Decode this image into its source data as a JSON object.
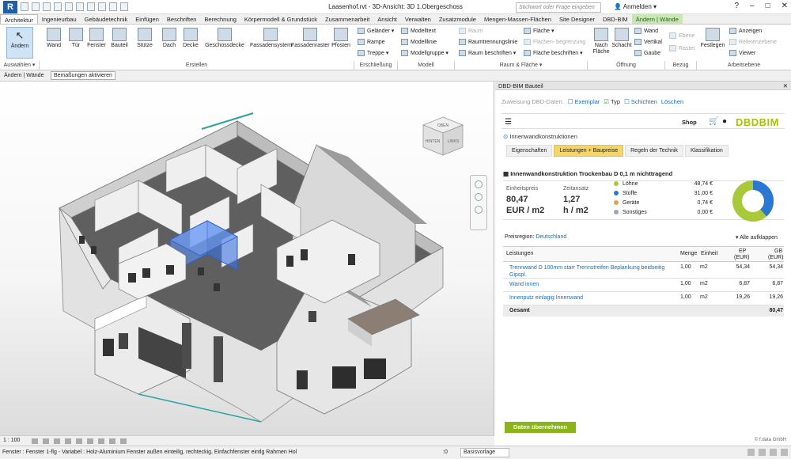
{
  "window": {
    "title": "Laasenhof.rvt - 3D-Ansicht: 3D 1.Obergeschoss",
    "search_placeholder": "Stichwort oder Frage eingeben",
    "signin": "Anmelden",
    "help": "?"
  },
  "ribbon_tabs": [
    "Architektur",
    "Ingenieurbau",
    "Gebäudetechnik",
    "Einfügen",
    "Beschriften",
    "Berechnung",
    "Körpermodell & Grundstück",
    "Zusammenarbeit",
    "Ansicht",
    "Verwalten",
    "Zusatzmodule",
    "Mengen-Massen-Flächen",
    "Site Designer",
    "DBD-BIM",
    "Ändern | Wände"
  ],
  "ribbon": {
    "modify": "Ändern",
    "select": "Auswählen ▾",
    "build": [
      "Wand",
      "Tür",
      "Fenster",
      "Bauteil",
      "Stütze",
      "Dach",
      "Decke",
      "Geschossdecke",
      "Fassadensystem",
      "Fassadenraster",
      "Pfosten"
    ],
    "circ": [
      "Geländer ▾",
      "Rampe",
      "Treppe ▾"
    ],
    "model": [
      "Modelltext",
      "Modelllinie",
      "Modellgruppe ▾"
    ],
    "room": [
      "Raum",
      "Raumtrennungslinie",
      "Raum  beschriften ▾",
      "Fläche ▾",
      "Flächen- begrenzung",
      "Fläche  beschriften ▾"
    ],
    "opening_big": [
      "Nach Fläche",
      "Schacht"
    ],
    "opening_small": [
      "Wand",
      "Vertikal",
      "Gaube"
    ],
    "datum": [
      "Ebene",
      "Raster"
    ],
    "workplane_big": "Festlegen",
    "workplane_small": [
      "Anzeigen",
      "Referenzebene",
      "Viewer"
    ],
    "groups": [
      "Erstellen",
      "Erschließung",
      "Modell",
      "Raum & Fläche ▾",
      "Öffnung",
      "Bezug",
      "Arbeitsebene"
    ]
  },
  "optionsbar": {
    "mode": "Ändern | Wände",
    "dims": "Bemaßungen aktivieren"
  },
  "viewcube": {
    "top": "OBEN",
    "left": "HINTEN",
    "right": "LINKS"
  },
  "viewbar": {
    "scale": "1 : 100"
  },
  "status": {
    "message": "Fenster : Fenster 1-flg - Variabel : Holz-Aluminium Fenster außen einteilig, rechteckig, Einfachfenster eintlg Rahmen Hol",
    "model": "Basisvorlage",
    "zero": ":0"
  },
  "panel": {
    "title": "DBD-BIM Bauteil",
    "close": "✕",
    "assign_label": "Zuweisung DBD-Daten:",
    "assign_opts": [
      "Exemplar",
      "Typ",
      "Schichten",
      "Löschen"
    ],
    "shop": "Shop",
    "logo": "DBDBIM",
    "breadcrumb": "Innenwandkonstruktionen",
    "tabs": [
      "Eigenschaften",
      "Leistungen + Baupreise",
      "Regeln der Technik",
      "Klassifikation"
    ],
    "heading": "Innenwandkonstruktion Trockenbau D 0,1 m nichttragend",
    "unit_price_label": "Einheitspreis",
    "unit_price": "80,47",
    "unit_price_unit": "EUR / m2",
    "time_label": "Zeitansatz",
    "time_value": "1,27",
    "time_unit": "h / m2",
    "costs": [
      {
        "name": "Löhne",
        "value": "48,74 €",
        "color": "#a9c93a"
      },
      {
        "name": "Stoffe",
        "value": "31,00 €",
        "color": "#2a78d2"
      },
      {
        "name": "Geräte",
        "value": "0,74 €",
        "color": "#e8a055"
      },
      {
        "name": "Sonstiges",
        "value": "0,00 €",
        "color": "#9aa7b4"
      }
    ],
    "region_label": "Preisregion:",
    "region": "Deutschland",
    "expand_all": "▾ Alle aufklappen",
    "table_headers": {
      "name": "Leistungen",
      "qty": "Menge",
      "unit": "Einheit",
      "ep": "EP",
      "ep_u": "(EUR)",
      "gb": "GB",
      "gb_u": "(EUR)"
    },
    "rows": [
      {
        "name": "Trennwand D 100mm starr Trennstreifen Beplankung beidseitig Gipspl.",
        "qty": "1,00",
        "unit": "m2",
        "ep": "54,34",
        "gb": "54,34"
      },
      {
        "name": "Wand innen",
        "qty": "1,00",
        "unit": "m2",
        "ep": "6,87",
        "gb": "6,87"
      },
      {
        "name": "Innenputz einlagig Innenwand",
        "qty": "1,00",
        "unit": "m2",
        "ep": "19,26",
        "gb": "19,26"
      }
    ],
    "total_label": "Gesamt",
    "total": "80,47",
    "apply": "Daten übernehmen",
    "copyright": "© f:data GmbH"
  }
}
